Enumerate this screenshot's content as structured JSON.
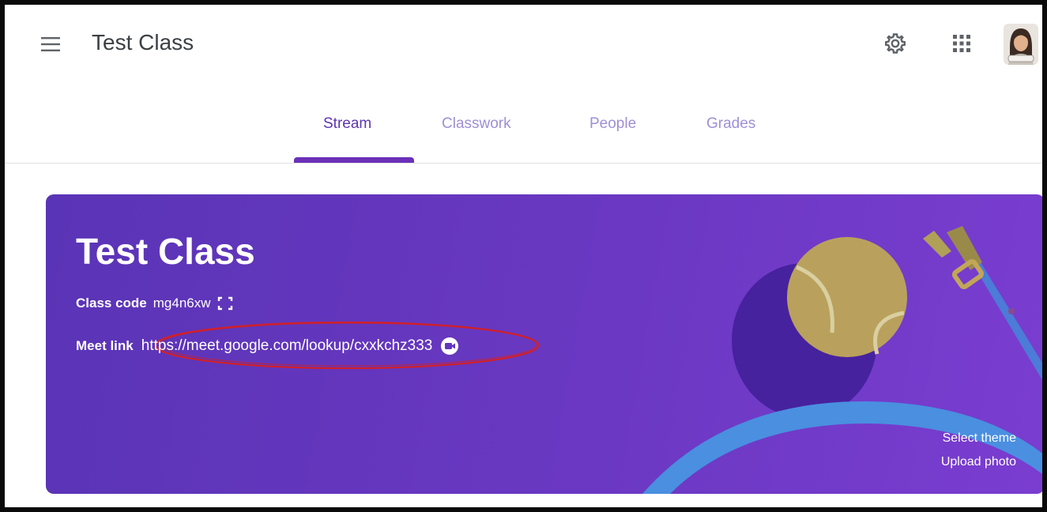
{
  "header": {
    "title": "Test Class",
    "icons": [
      "hamburger-menu-icon",
      "gear-icon",
      "apps-grid-icon",
      "avatar"
    ]
  },
  "tabs": [
    {
      "label": "Stream",
      "active": true
    },
    {
      "label": "Classwork",
      "active": false
    },
    {
      "label": "People",
      "active": false
    },
    {
      "label": "Grades",
      "active": false
    }
  ],
  "banner": {
    "title": "Test Class",
    "class_code_label": "Class code",
    "class_code": "mg4n6xw",
    "meet_label": "Meet link",
    "meet_url": "https://meet.google.com/lookup/cxxkchz333",
    "select_theme": "Select theme",
    "upload_photo": "Upload photo"
  },
  "colors": {
    "accent": "#6a30b8",
    "banner": "#6236bd",
    "annotation": "#d0202a"
  }
}
